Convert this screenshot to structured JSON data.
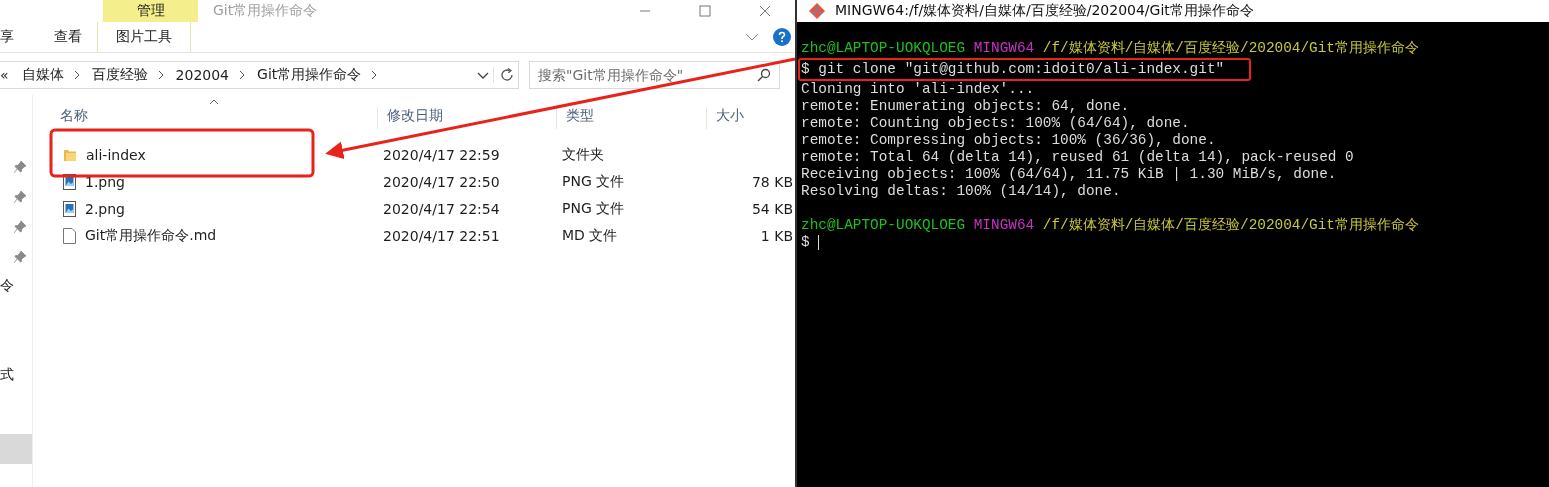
{
  "explorer": {
    "context_tab": "管理",
    "title": "Git常用操作命令",
    "ribbon_tabs": [
      {
        "label": "享",
        "kind": "normal"
      },
      {
        "label": "查看",
        "kind": "normal"
      },
      {
        "label": "图片工具",
        "kind": "context"
      }
    ],
    "overflow": "«",
    "breadcrumbs": [
      "自媒体",
      "百度经验",
      "202004",
      "Git常用操作命令"
    ],
    "search": {
      "placeholder": "搜索\"Git常用操作命令\""
    },
    "nav_pane": {
      "items": [
        {
          "label": "令"
        },
        {
          "label": "式"
        }
      ]
    },
    "columns": [
      "名称",
      "修改日期",
      "类型",
      "大小"
    ],
    "rows": [
      {
        "name": "ali-index",
        "date": "2020/4/17 22:59",
        "type": "文件夹",
        "kind": "folder"
      },
      {
        "name": "1.png",
        "date": "2020/4/17 22:50",
        "type": "PNG 文件",
        "size": "78 KB",
        "kind": "image"
      },
      {
        "name": "2.png",
        "date": "2020/4/17 22:54",
        "type": "PNG 文件",
        "size": "54 KB",
        "kind": "image"
      },
      {
        "name": "Git常用操作命令.md",
        "date": "2020/4/17 22:51",
        "type": "MD 文件",
        "size": "1 KB",
        "kind": "file"
      }
    ]
  },
  "terminal": {
    "title": "MINGW64:/f/媒体资料/自媒体/百度经验/202004/Git常用操作命令",
    "lines": [
      {
        "kind": "text",
        "segments": [
          {
            "text": "zhc@LAPTOP-UOKQLOEG",
            "kind": "user"
          },
          {
            "text": " MINGW64",
            "kind": "host"
          },
          {
            "text": " /f/媒体资料/自媒体/百度经验/202004/Git常用操作命令",
            "kind": "path"
          }
        ]
      },
      {
        "kind": "text",
        "highlighted": true,
        "segments": [
          {
            "text": "$ git clone \"git@github.com:idoit0/ali-index.git\"",
            "kind": "plain"
          }
        ]
      },
      {
        "kind": "text",
        "segments": [
          {
            "text": "Cloning into 'ali-index'...",
            "kind": "plain"
          }
        ]
      },
      {
        "kind": "text",
        "segments": [
          {
            "text": "remote: Enumerating objects: 64, done.",
            "kind": "plain"
          }
        ]
      },
      {
        "kind": "text",
        "segments": [
          {
            "text": "remote: Counting objects: 100% (64/64), done.",
            "kind": "plain"
          }
        ]
      },
      {
        "kind": "text",
        "segments": [
          {
            "text": "remote: Compressing objects: 100% (36/36), done.",
            "kind": "plain"
          }
        ]
      },
      {
        "kind": "text",
        "segments": [
          {
            "text": "remote: Total 64 (delta 14), reused 61 (delta 14), pack-reused 0",
            "kind": "plain"
          }
        ]
      },
      {
        "kind": "text",
        "segments": [
          {
            "text": "Receiving objects: 100% (64/64), 11.75 KiB | 1.30 MiB/s, done.",
            "kind": "plain"
          }
        ]
      },
      {
        "kind": "text",
        "segments": [
          {
            "text": "Resolving deltas: 100% (14/14), done.",
            "kind": "plain"
          }
        ]
      },
      {
        "kind": "blank"
      },
      {
        "kind": "text",
        "segments": [
          {
            "text": "zhc@LAPTOP-UOKQLOEG",
            "kind": "user"
          },
          {
            "text": " MINGW64",
            "kind": "host"
          },
          {
            "text": " /f/媒体资料/自媒体/百度经验/202004/Git常用操作命令",
            "kind": "path"
          }
        ]
      },
      {
        "kind": "text",
        "segments": [
          {
            "text": "$",
            "kind": "plain"
          },
          {
            "kind": "cursor"
          }
        ]
      }
    ]
  }
}
